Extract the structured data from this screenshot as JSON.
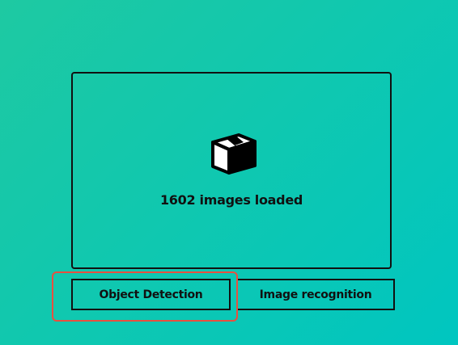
{
  "upload": {
    "icon": "package-box-icon",
    "status_text": "1602 images loaded"
  },
  "modes": {
    "object_detection_label": "Object Detection",
    "image_recognition_label": "Image recognition"
  },
  "colors": {
    "background_start": "#1ec9a2",
    "background_end": "#00c6c0",
    "border": "#111111",
    "highlight": "#e8503f"
  }
}
